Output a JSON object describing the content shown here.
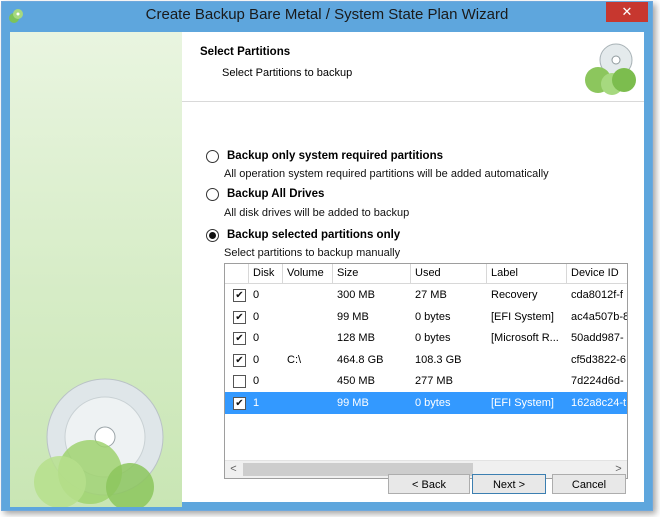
{
  "window": {
    "title": "Create Backup Bare Metal / System State Plan Wizard",
    "close_glyph": "✕"
  },
  "header": {
    "title": "Select Partitions",
    "subtitle": "Select Partitions to backup"
  },
  "options": [
    {
      "label": "Backup only system required partitions",
      "desc": "All operation system required partitions will be added automatically",
      "selected": false
    },
    {
      "label": "Backup All Drives",
      "desc": "All disk drives will be added to backup",
      "selected": false
    },
    {
      "label": "Backup selected partitions only",
      "desc": "Select partitions to backup manually",
      "selected": true
    }
  ],
  "table": {
    "columns": [
      "Disk",
      "Volume",
      "Size",
      "Used",
      "Label",
      "Device ID"
    ],
    "rows": [
      {
        "checked": true,
        "disk": "0",
        "volume": "",
        "size": "300 MB",
        "used": "27 MB",
        "label": "Recovery",
        "device": "cda8012f-f",
        "selected": false
      },
      {
        "checked": true,
        "disk": "0",
        "volume": "",
        "size": "99 MB",
        "used": "0 bytes",
        "label": "[EFI System]",
        "device": "ac4a507b-8",
        "selected": false
      },
      {
        "checked": true,
        "disk": "0",
        "volume": "",
        "size": "128 MB",
        "used": "0 bytes",
        "label": "[Microsoft R...",
        "device": "50add987-",
        "selected": false
      },
      {
        "checked": true,
        "disk": "0",
        "volume": "C:\\",
        "size": "464.8 GB",
        "used": "108.3 GB",
        "label": "",
        "device": "cf5d3822-6",
        "selected": false
      },
      {
        "checked": false,
        "disk": "0",
        "volume": "",
        "size": "450 MB",
        "used": "277 MB",
        "label": "",
        "device": "7d224d6d-",
        "selected": false
      },
      {
        "checked": true,
        "disk": "1",
        "volume": "",
        "size": "99 MB",
        "used": "0 bytes",
        "label": "[EFI System]",
        "device": "162a8c24-t",
        "selected": true
      }
    ],
    "scroll_left": "<",
    "scroll_right": ">"
  },
  "buttons": {
    "back": "< Back",
    "next": "Next >",
    "cancel": "Cancel"
  },
  "colors": {
    "titlebar": "#5ea6dd",
    "selection": "#3399ff",
    "close": "#c7372f"
  }
}
